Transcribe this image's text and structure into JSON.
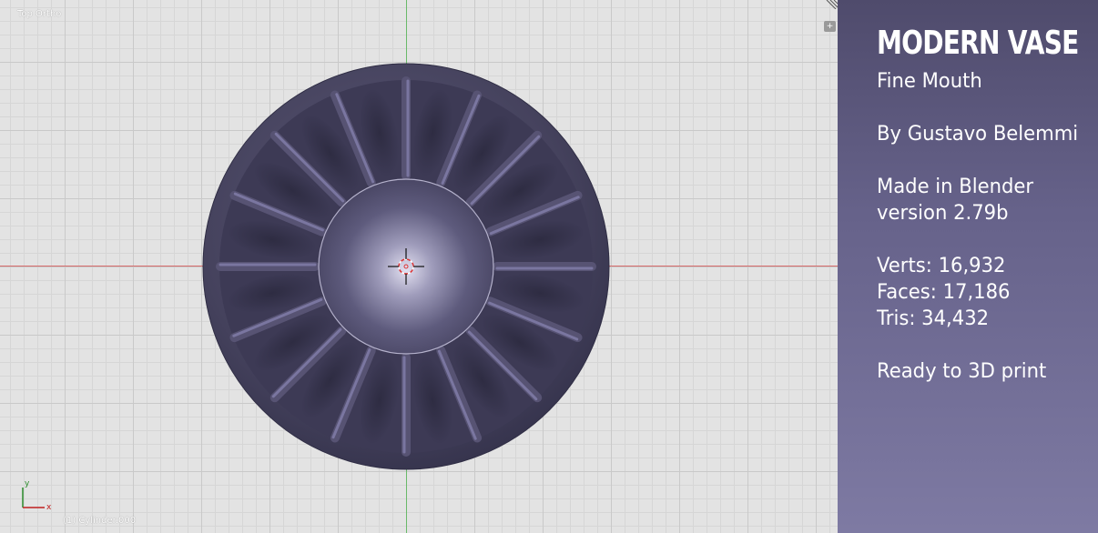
{
  "viewport": {
    "view_name": "Top Ortho",
    "object_name": "(1) Cylinder.000",
    "gizmo": {
      "y_label": "y",
      "x_label": "x"
    },
    "colors": {
      "background": "#e3e3e3",
      "x_axis": "#d76a6a",
      "y_axis": "#6ab96a",
      "vase_body": "#3f3c56",
      "vase_highlight": "#c9c6dd"
    }
  },
  "info_panel": {
    "title": "MODERN VASE",
    "subtitle": "Fine Mouth",
    "author": "By Gustavo Belemmi",
    "made_in": "Made in Blender",
    "version": "version 2.79b",
    "verts": "Verts: 16,932",
    "faces": "Faces: 17,186",
    "tris": "Tris: 34,432",
    "ready": "Ready to 3D print",
    "colors": {
      "top": "#4f4b6c",
      "bottom": "#7e7aa3",
      "text": "#ffffff"
    }
  }
}
